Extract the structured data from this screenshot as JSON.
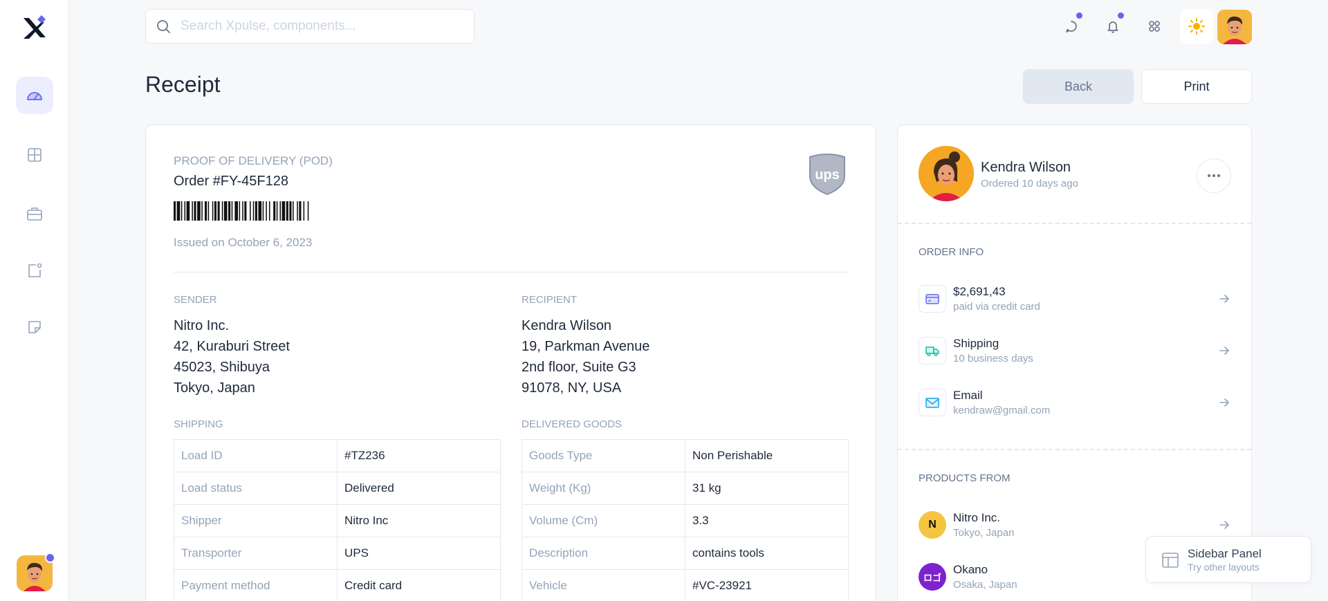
{
  "search": {
    "placeholder": "Search Xpulse, components..."
  },
  "page": {
    "title": "Receipt"
  },
  "actions": {
    "back_label": "Back",
    "print_label": "Print"
  },
  "receipt": {
    "pod_label": "PROOF OF DELIVERY (POD)",
    "order_number": "Order #FY-45F128",
    "issued": "Issued on October 6, 2023",
    "carrier_icon": "ups-logo",
    "sender": {
      "label": "SENDER",
      "lines": [
        "Nitro Inc.",
        "42, Kuraburi Street",
        "45023, Shibuya",
        "Tokyo, Japan"
      ]
    },
    "recipient": {
      "label": "RECIPIENT",
      "lines": [
        "Kendra Wilson",
        "19, Parkman Avenue",
        "2nd floor, Suite G3",
        "91078, NY, USA"
      ]
    },
    "shipping": {
      "label": "SHIPPING",
      "rows": [
        {
          "key": "Load ID",
          "value": "#TZ236"
        },
        {
          "key": "Load status",
          "value": "Delivered"
        },
        {
          "key": "Shipper",
          "value": "Nitro Inc"
        },
        {
          "key": "Transporter",
          "value": "UPS"
        },
        {
          "key": "Payment method",
          "value": "Credit card"
        }
      ]
    },
    "goods": {
      "label": "DELIVERED GOODS",
      "rows": [
        {
          "key": "Goods Type",
          "value": "Non Perishable"
        },
        {
          "key": "Weight (Kg)",
          "value": "31 kg"
        },
        {
          "key": "Volume (Cm)",
          "value": "3.3"
        },
        {
          "key": "Description",
          "value": "contains tools"
        },
        {
          "key": "Vehicle",
          "value": "#VC-23921"
        }
      ]
    }
  },
  "customer": {
    "name": "Kendra Wilson",
    "subtitle": "Ordered 10 days ago"
  },
  "order_info": {
    "label": "ORDER INFO",
    "items": [
      {
        "title": "$2,691,43",
        "subtitle": "paid via credit card",
        "icon": "credit-card-icon",
        "color": "#6366f1"
      },
      {
        "title": "Shipping",
        "subtitle": "10 business days",
        "icon": "truck-icon",
        "color": "#14b8a6"
      },
      {
        "title": "Email",
        "subtitle": "kendraw@gmail.com",
        "icon": "mail-icon",
        "color": "#0ea5e9"
      }
    ]
  },
  "products": {
    "label": "PRODUCTS FROM",
    "items": [
      {
        "name": "Nitro Inc.",
        "location": "Tokyo, Japan",
        "logo_text": "N",
        "logo_color": "#f5c542"
      },
      {
        "name": "Okano",
        "location": "Osaka, Japan",
        "logo_text": "ロゴ",
        "logo_color": "#7e22ce"
      }
    ]
  },
  "floating_panel": {
    "title": "Sidebar Panel",
    "subtitle": "Try other layouts"
  },
  "colors": {
    "accent": "#6366f1",
    "sun": "#f5b000"
  }
}
